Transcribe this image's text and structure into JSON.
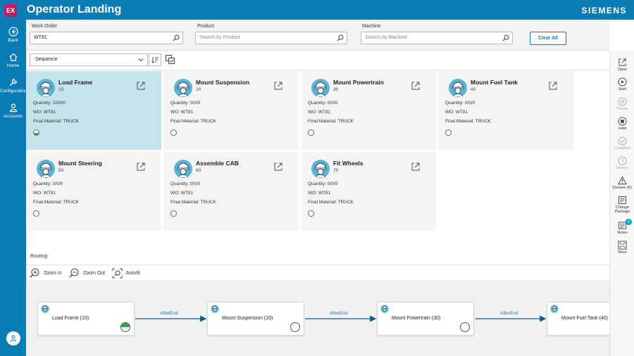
{
  "app": {
    "badge": "EX",
    "title": "Operator Landing",
    "brand": "SIEMENS"
  },
  "leftnav": [
    {
      "label": "Back",
      "icon": "back-icon"
    },
    {
      "label": "Home",
      "icon": "home-icon"
    },
    {
      "label": "Configuration",
      "icon": "wrench-icon"
    },
    {
      "label": "Accounts",
      "icon": "person-icon"
    }
  ],
  "filters": {
    "work_order": {
      "label": "Work Order",
      "value": "WT81"
    },
    "product": {
      "label": "Product",
      "placeholder": "Search by Product"
    },
    "machine": {
      "label": "Machine",
      "placeholder": "Search by Machine"
    },
    "clear_label": "Clear All"
  },
  "toolbar": {
    "sort_value": "Sequence"
  },
  "cards": [
    {
      "name": "Load Frame",
      "number": "10",
      "quantity": "Quantity: 10/0/0",
      "wo": "WO: WT81",
      "material": "Final Material: TRUCK",
      "status": "half",
      "selected": true
    },
    {
      "name": "Mount Suspension",
      "number": "20",
      "quantity": "Quantity: 0/0/0",
      "wo": "WO: WT81",
      "material": "Final Material: TRUCK",
      "status": "empty",
      "selected": false
    },
    {
      "name": "Mount Powertrain",
      "number": "30",
      "quantity": "Quantity: 0/0/0",
      "wo": "WO: WT81",
      "material": "Final Material: TRUCK",
      "status": "empty",
      "selected": false
    },
    {
      "name": "Mount Fuel Tank",
      "number": "40",
      "quantity": "Quantity: 0/0/0",
      "wo": "WO: WT81",
      "material": "Final Material: TRUCK",
      "status": "empty",
      "selected": false
    },
    {
      "name": "Mount Steering",
      "number": "50",
      "quantity": "Quantity: 0/0/0",
      "wo": "WO: WT81",
      "material": "Final Material: TRUCK",
      "status": "empty",
      "selected": false
    },
    {
      "name": "Assemble CAB",
      "number": "60",
      "quantity": "Quantity: 0/0/0",
      "wo": "WO: WT81",
      "material": "Final Material: TRUCK",
      "status": "empty",
      "selected": false
    },
    {
      "name": "Fit Wheels",
      "number": "70",
      "quantity": "Quantity: 0/0/0",
      "wo": "WO: WT81",
      "material": "Final Material: TRUCK",
      "status": "empty",
      "selected": false
    }
  ],
  "routing": {
    "label": "Routing",
    "zoom_in": "Zoom In",
    "zoom_out": "Zoom Out",
    "autofit": "Autofit",
    "nodes": [
      {
        "label": "Load Frame (10)",
        "status": "half"
      },
      {
        "label": "Mount Suspension (20)",
        "status": "empty"
      },
      {
        "label": "Mount Powertrain (30)",
        "status": "empty"
      },
      {
        "label": "Mount Fuel Tank (40)",
        "status": "empty"
      }
    ],
    "edge_label": "AfterEnd"
  },
  "rightbar": [
    {
      "label": "Open",
      "icon": "open-icon",
      "enabled": true
    },
    {
      "label": "Start",
      "icon": "play-icon",
      "enabled": true
    },
    {
      "label": "Pause",
      "icon": "pause-icon",
      "enabled": false
    },
    {
      "label": "Hold",
      "icon": "hold-icon",
      "enabled": true
    },
    {
      "label": "Complete",
      "icon": "check-icon",
      "enabled": false
    },
    {
      "label": "History",
      "icon": "history-icon",
      "enabled": false
    },
    {
      "label": "Declare NC",
      "icon": "warning-icon",
      "enabled": true
    },
    {
      "label": "Change Package",
      "icon": "package-icon",
      "enabled": true
    },
    {
      "label": "Notes",
      "icon": "notes-icon",
      "enabled": true,
      "badge": "0"
    },
    {
      "label": "More",
      "icon": "expand-icon",
      "enabled": true
    }
  ]
}
